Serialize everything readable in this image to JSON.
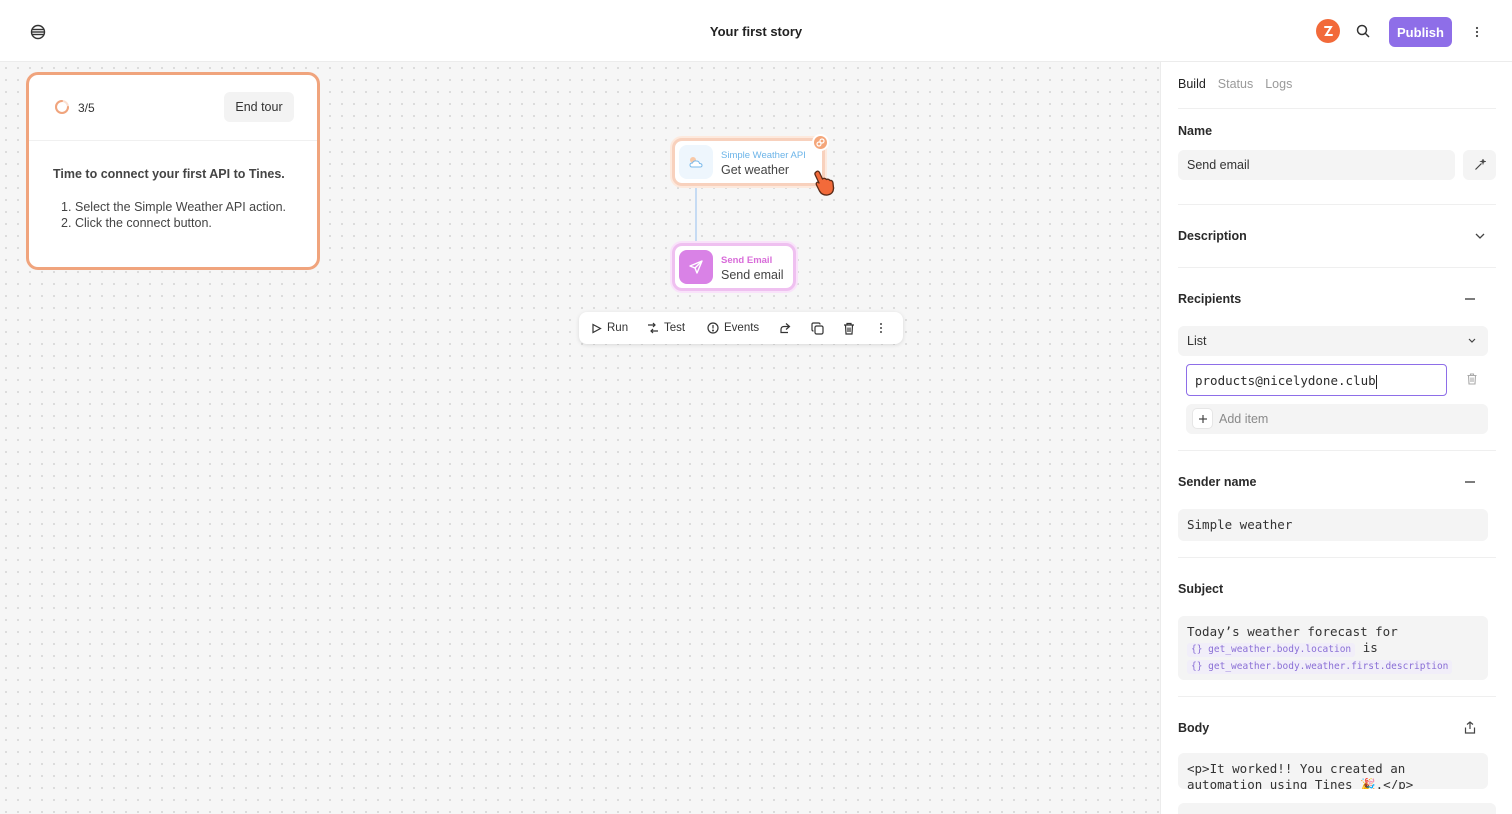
{
  "header": {
    "story_title": "Your first story",
    "publish_label": "Publish"
  },
  "tour": {
    "step": "3/5",
    "end_label": "End tour",
    "heading": "Time to connect your first API to Tines.",
    "steps": [
      {
        "num": "1.",
        "text": "Select the Simple Weather API action."
      },
      {
        "num": "2.",
        "text": "Click the connect button."
      }
    ]
  },
  "nodes": {
    "weather": {
      "type": "Simple Weather API",
      "name": "Get weather"
    },
    "email": {
      "type": "Send Email",
      "name": "Send email"
    }
  },
  "toolbar": {
    "run_label": "Run",
    "test_label": "Test",
    "events_label": "Events"
  },
  "panel": {
    "tabs": [
      "Build",
      "Status",
      "Logs"
    ],
    "active_tab": "Build",
    "name_label": "Name",
    "name_value": "Send email",
    "description_label": "Description",
    "recipients_label": "Recipients",
    "recipients_mode": "List",
    "recipient_email": "products@nicelydone.club",
    "add_item_label": "Add item",
    "sender_label": "Sender name",
    "sender_value": "Simple weather",
    "subject_label": "Subject",
    "subject_text_1": "Today’s weather forecast for",
    "subject_pill_1": "{} get_weather.body.location",
    "subject_text_2": "is",
    "subject_pill_2": "{} get_weather.body.weather.first.description",
    "body_label": "Body",
    "body_line_1": "<p>It worked!! You created an",
    "body_line_2": "automation using Tines 🎉.</p>"
  },
  "colors": {
    "accent": "#8e6ee8",
    "tour_border": "#f0a47d",
    "tines_orange": "#f26a3a",
    "email_node": "#d982e6",
    "weather_type": "#6cb4e8"
  }
}
